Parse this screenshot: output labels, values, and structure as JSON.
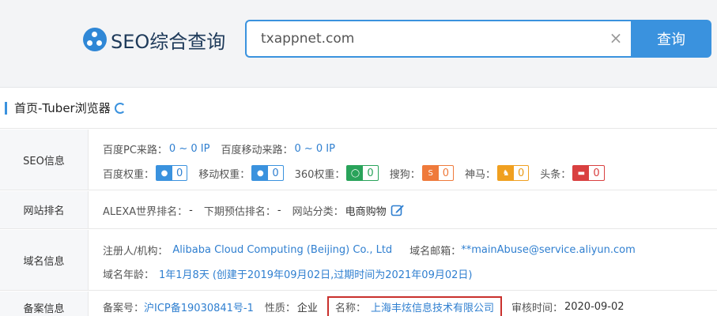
{
  "header": {
    "logo_text": "SEO综合查询",
    "search_value": "txappnet.com",
    "search_button": "查询",
    "clear_icon": "×"
  },
  "panel": {
    "title": "首页-Tuber浏览器"
  },
  "seo": {
    "label": "SEO信息",
    "pc_traffic_label": "百度PC来路：",
    "pc_traffic_value": "0 ~ 0 IP",
    "mobile_traffic_label": "百度移动来路：",
    "mobile_traffic_value": "0 ~ 0 IP",
    "baidu_weight_label": "百度权重：",
    "baidu_weight_value": "0",
    "mobile_weight_label": "移动权重：",
    "mobile_weight_value": "0",
    "s360_weight_label": "360权重：",
    "s360_weight_value": "0",
    "sogou_label": "搜狗：",
    "sogou_value": "0",
    "shenma_label": "神马：",
    "shenma_value": "0",
    "toutiao_label": "头条：",
    "toutiao_value": "0"
  },
  "rank": {
    "label": "网站排名",
    "alexa_label": "ALEXA世界排名：",
    "alexa_value": "-",
    "forecast_label": "下期预估排名：",
    "forecast_value": "-",
    "category_label": "网站分类：",
    "category_value": "电商购物"
  },
  "domain": {
    "label": "域名信息",
    "registrant_label": "注册人/机构：",
    "registrant_value": "Alibaba Cloud Computing (Beijing) Co., Ltd",
    "email_label": "域名邮箱：",
    "email_value": "**mainAbuse@service.aliyun.com",
    "age_label": "域名年龄：",
    "age_value": "1年1月8天",
    "age_detail": "(创建于2019年09月02日,过期时间为2021年09月02日)"
  },
  "icp": {
    "label": "备案信息",
    "number_label": "备案号：",
    "number_value": "沪ICP备19030841号-1",
    "nature_label": "性质：",
    "nature_value": "企业",
    "name_label": "名称：",
    "name_value": "上海丰炫信息技术有限公司",
    "review_label": "审核时间：",
    "review_value": "2020-09-02"
  },
  "colors": {
    "accent": "#3a92de",
    "highlight_border": "#c9302c"
  }
}
